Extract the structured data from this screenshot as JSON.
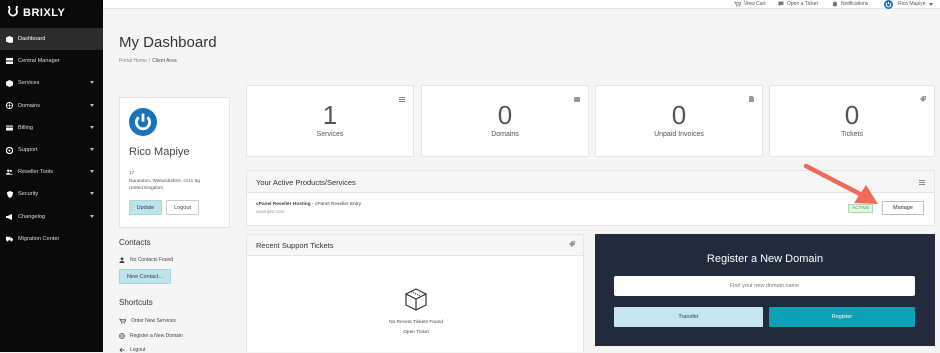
{
  "brand": {
    "name": "BRIXLY"
  },
  "sidebar": {
    "items": [
      {
        "label": "Dashboard",
        "icon": "dashboard-icon",
        "caret": false,
        "active": true
      },
      {
        "label": "Central Manager",
        "icon": "server-icon",
        "caret": false
      },
      {
        "label": "Services",
        "icon": "cube-icon",
        "caret": true
      },
      {
        "label": "Domains",
        "icon": "globe-icon",
        "caret": true
      },
      {
        "label": "Billing",
        "icon": "credit-card-icon",
        "caret": true
      },
      {
        "label": "Support",
        "icon": "life-ring-icon",
        "caret": true
      },
      {
        "label": "Reseller Tools",
        "icon": "users-icon",
        "caret": true
      },
      {
        "label": "Security",
        "icon": "shield-icon",
        "caret": true
      },
      {
        "label": "Changelog",
        "icon": "megaphone-icon",
        "caret": true
      },
      {
        "label": "Migration Center",
        "icon": "truck-icon",
        "caret": false
      }
    ]
  },
  "topbar": {
    "view_cart": "View Cart",
    "open_ticket": "Open a Ticket",
    "notifications": "Notifications",
    "user_name": "Rico Mapiye"
  },
  "page": {
    "title": "My Dashboard",
    "breadcrumb_home": "Portal Home",
    "breadcrumb_sep": "/",
    "breadcrumb_current": "Client Area"
  },
  "profile": {
    "name": "Rico Mapiye",
    "address_line1": "17",
    "address_line2": "Nuneaton, Warwickshire, cv11 5g",
    "address_line3": "United Kingdom",
    "update_label": "Update",
    "logout_label": "Logout"
  },
  "contacts": {
    "title": "Contacts",
    "empty": "No Contacts Found",
    "new_label": "New Contact..."
  },
  "shortcuts": {
    "title": "Shortcuts",
    "items": [
      "Order New Services",
      "Register a New Domain",
      "Logout"
    ]
  },
  "stats": [
    {
      "value": "1",
      "label": "Services",
      "icon": "list-icon"
    },
    {
      "value": "0",
      "label": "Domains",
      "icon": "globe-icon"
    },
    {
      "value": "0",
      "label": "Unpaid Invoices",
      "icon": "invoice-icon"
    },
    {
      "value": "0",
      "label": "Tickets",
      "icon": "tag-icon"
    }
  ],
  "products": {
    "title": "Your Active Products/Services",
    "product_name": "cPanel Reseller Hosting",
    "product_sub": " - cPanel Reseller Entry",
    "domain": "example.com",
    "status": "ACTIVE",
    "manage_label": "Manage"
  },
  "tickets": {
    "title": "Recent Support Tickets",
    "empty": "No Recent Tickets Found",
    "open_label": "Open Ticket"
  },
  "register": {
    "title": "Register a New Domain",
    "placeholder": "Find your new domain name",
    "transfer_label": "Transfer",
    "register_label": "Register"
  },
  "colors": {
    "accent": "#0ea0b5",
    "dark_panel": "#232a3c",
    "active_badge": "#5cb85c",
    "arrow": "#ef6a5a",
    "brand_blue": "#1a73b8"
  }
}
